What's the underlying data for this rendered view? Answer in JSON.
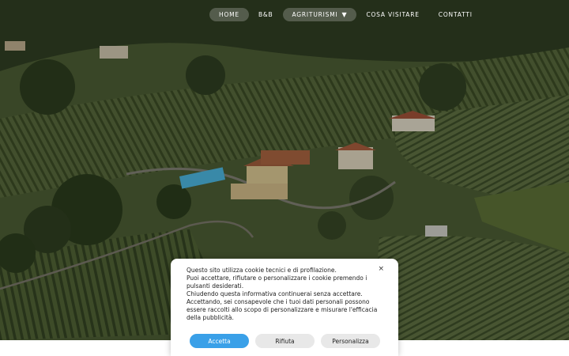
{
  "nav": {
    "items": [
      {
        "label": "HOME",
        "active": true
      },
      {
        "label": "B&B",
        "active": false
      },
      {
        "label": "AGRITURISMI",
        "active": false,
        "has_dropdown": true
      },
      {
        "label": "COSA VISITARE",
        "active": false
      },
      {
        "label": "CONTATTI",
        "active": false
      }
    ],
    "dropdown_icon": "caret-down-icon"
  },
  "cookie_banner": {
    "lines": [
      "Questo sito utilizza cookie tecnici e di profilazione.",
      "Puoi accettare, rifiutare o personalizzare i cookie premendo i pulsanti desiderati.",
      "Chiudendo questa informativa continuerai senza accettare.",
      "Accettando, sei consapevole che i tuoi dati personali possono essere raccolti allo scopo di personalizzare e misurare l'efficacia della pubblicità."
    ],
    "close_label": "×",
    "accept_label": "Accetta",
    "reject_label": "Rifiuta",
    "customize_label": "Personalizza"
  },
  "colors": {
    "accent": "#3aa0e8",
    "button_secondary": "#e8e8e8"
  }
}
